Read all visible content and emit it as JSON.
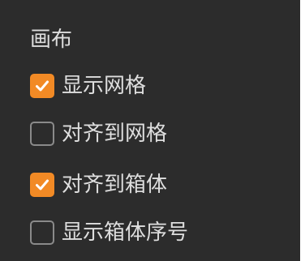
{
  "panel": {
    "title": "画布",
    "options": [
      {
        "label": "显示网格",
        "checked": true
      },
      {
        "label": "对齐到网格",
        "checked": false
      },
      {
        "label": "对齐到箱体",
        "checked": true
      },
      {
        "label": "显示箱体序号",
        "checked": false
      }
    ]
  },
  "colors": {
    "background": "#2c2c2c",
    "accent": "#f28a25",
    "text": "#dedede",
    "unchecked_border": "#8a8a8a"
  }
}
